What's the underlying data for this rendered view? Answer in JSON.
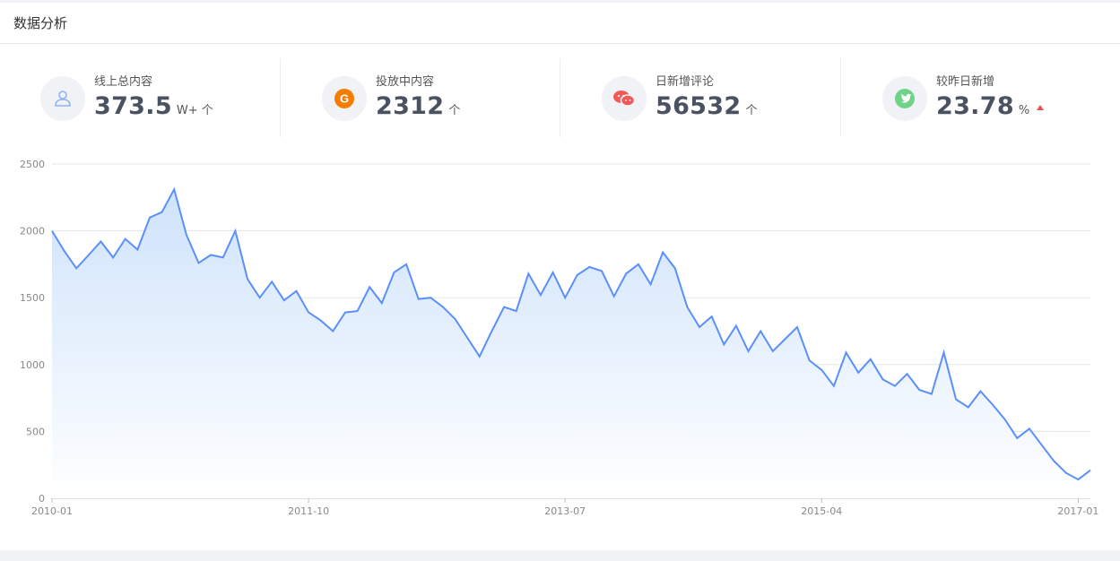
{
  "header": {
    "title": "数据分析"
  },
  "stats": [
    {
      "label": "线上总内容",
      "value": "373.5",
      "unit": "W+ 个",
      "icon": "user-icon"
    },
    {
      "label": "投放中内容",
      "value": "2312",
      "unit": "个",
      "icon": "google-icon"
    },
    {
      "label": "日新增评论",
      "value": "56532",
      "unit": "个",
      "icon": "wechat-icon"
    },
    {
      "label": "较昨日新增",
      "value": "23.78",
      "unit": "%",
      "icon": "twitter-icon",
      "trend": "up"
    }
  ],
  "colors": {
    "line": "#5b8ff9",
    "area_top": "#cfe3fb",
    "area_bottom": "#ffffff",
    "up": "#ef5350"
  },
  "chart_data": {
    "type": "area",
    "x_start": "2010-01",
    "x_interval": "month",
    "xticks": [
      "2010-01",
      "2011-10",
      "2013-07",
      "2015-04",
      "2017-01"
    ],
    "yticks": [
      0,
      500,
      1000,
      1500,
      2000,
      2500
    ],
    "ylim": [
      0,
      2500
    ],
    "grid": true,
    "values": [
      2000,
      1850,
      1720,
      1820,
      1920,
      1800,
      1940,
      1860,
      2100,
      2140,
      2310,
      1970,
      1760,
      1820,
      1800,
      2000,
      1640,
      1500,
      1620,
      1480,
      1550,
      1390,
      1330,
      1250,
      1390,
      1400,
      1580,
      1460,
      1690,
      1750,
      1490,
      1500,
      1430,
      1340,
      1200,
      1060,
      1250,
      1430,
      1400,
      1680,
      1520,
      1690,
      1500,
      1670,
      1730,
      1700,
      1510,
      1680,
      1750,
      1600,
      1840,
      1720,
      1430,
      1280,
      1360,
      1150,
      1290,
      1100,
      1250,
      1100,
      1190,
      1280,
      1030,
      960,
      840,
      1090,
      940,
      1040,
      890,
      840,
      930,
      810,
      780,
      1090,
      740,
      680,
      800,
      700,
      590,
      450,
      520,
      400,
      280,
      190,
      140,
      210
    ]
  }
}
